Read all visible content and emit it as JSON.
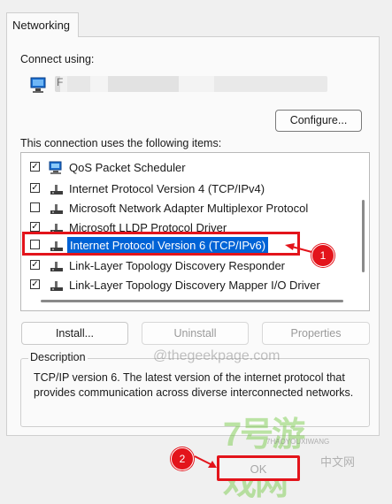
{
  "tabs": {
    "active": "Networking"
  },
  "connect_using": {
    "label": "Connect using:",
    "adapter_name_blurred": "F"
  },
  "buttons": {
    "configure": "Configure...",
    "install": "Install...",
    "uninstall": "Uninstall",
    "properties": "Properties",
    "ok": "OK"
  },
  "items_label": "This connection uses the following items:",
  "items": [
    {
      "label": "QoS Packet Scheduler",
      "checked": true,
      "icon": "qos-scheduler-icon"
    },
    {
      "label": "Internet Protocol Version 4 (TCP/IPv4)",
      "checked": true,
      "icon": "protocol-icon"
    },
    {
      "label": "Microsoft Network Adapter Multiplexor Protocol",
      "checked": false,
      "icon": "protocol-icon"
    },
    {
      "label": "Microsoft LLDP Protocol Driver",
      "checked": true,
      "icon": "protocol-icon"
    },
    {
      "label": "Internet Protocol Version 6 (TCP/IPv6)",
      "checked": false,
      "icon": "protocol-icon",
      "selected": true
    },
    {
      "label": "Link-Layer Topology Discovery Responder",
      "checked": true,
      "icon": "protocol-icon"
    },
    {
      "label": "Link-Layer Topology Discovery Mapper I/O Driver",
      "checked": true,
      "icon": "protocol-icon"
    }
  ],
  "description": {
    "title": "Description",
    "text": "TCP/IP version 6. The latest version of the internet protocol that provides communication across diverse interconnected networks."
  },
  "annotations": {
    "step1": "1",
    "step2": "2",
    "accent": "#e3141b"
  },
  "watermarks": {
    "site": "@thegeekpage.com",
    "logo": "7号游戏网",
    "logo_sub": "7HAOYOUXIWANG",
    "cn_site": "中文网"
  },
  "colors": {
    "selection": "#0063d6",
    "highlight": "#e3141b"
  }
}
